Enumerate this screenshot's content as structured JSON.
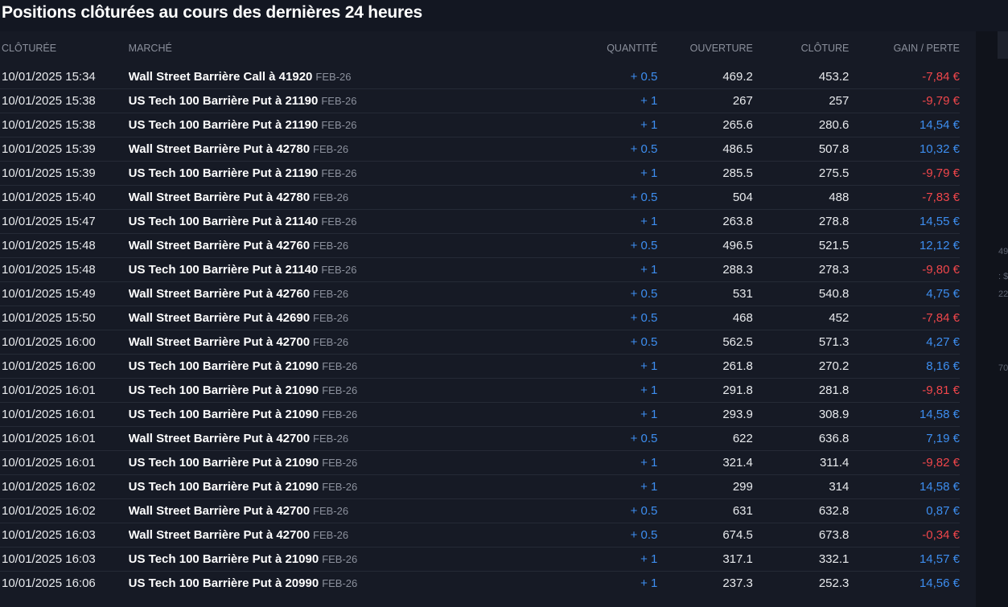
{
  "title": "Positions clôturées au cours des dernières 24 heures",
  "colors": {
    "background": "#131722",
    "panel": "#161a25",
    "positive": "#3d8ef0",
    "negative": "#f0464b",
    "header_text": "#8b909c"
  },
  "table": {
    "headers": {
      "closed": "CLÔTURÉE",
      "market": "MARCHÉ",
      "quantity": "QUANTITÉ",
      "open": "OUVERTURE",
      "close": "CLÔTURE",
      "pl": "GAIN / PERTE"
    },
    "rows": [
      {
        "date": "10/01/2025 15:34",
        "market": "Wall Street Barrière Call à 41920",
        "expiry": "FEB-26",
        "qty": "+ 0.5",
        "open": "469.2",
        "close": "453.2",
        "pl": "-7,84 €",
        "sign": "neg"
      },
      {
        "date": "10/01/2025 15:38",
        "market": "US Tech 100 Barrière Put à 21190",
        "expiry": "FEB-26",
        "qty": "+ 1",
        "open": "267",
        "close": "257",
        "pl": "-9,79 €",
        "sign": "neg"
      },
      {
        "date": "10/01/2025 15:38",
        "market": "US Tech 100 Barrière Put à 21190",
        "expiry": "FEB-26",
        "qty": "+ 1",
        "open": "265.6",
        "close": "280.6",
        "pl": "14,54 €",
        "sign": "pos"
      },
      {
        "date": "10/01/2025 15:39",
        "market": "Wall Street Barrière Put à 42780",
        "expiry": "FEB-26",
        "qty": "+ 0.5",
        "open": "486.5",
        "close": "507.8",
        "pl": "10,32 €",
        "sign": "pos"
      },
      {
        "date": "10/01/2025 15:39",
        "market": "US Tech 100 Barrière Put à 21190",
        "expiry": "FEB-26",
        "qty": "+ 1",
        "open": "285.5",
        "close": "275.5",
        "pl": "-9,79 €",
        "sign": "neg"
      },
      {
        "date": "10/01/2025 15:40",
        "market": "Wall Street Barrière Put à 42780",
        "expiry": "FEB-26",
        "qty": "+ 0.5",
        "open": "504",
        "close": "488",
        "pl": "-7,83 €",
        "sign": "neg"
      },
      {
        "date": "10/01/2025 15:47",
        "market": "US Tech 100 Barrière Put à 21140",
        "expiry": "FEB-26",
        "qty": "+ 1",
        "open": "263.8",
        "close": "278.8",
        "pl": "14,55 €",
        "sign": "pos"
      },
      {
        "date": "10/01/2025 15:48",
        "market": "Wall Street Barrière Put à 42760",
        "expiry": "FEB-26",
        "qty": "+ 0.5",
        "open": "496.5",
        "close": "521.5",
        "pl": "12,12 €",
        "sign": "pos"
      },
      {
        "date": "10/01/2025 15:48",
        "market": "US Tech 100 Barrière Put à 21140",
        "expiry": "FEB-26",
        "qty": "+ 1",
        "open": "288.3",
        "close": "278.3",
        "pl": "-9,80 €",
        "sign": "neg"
      },
      {
        "date": "10/01/2025 15:49",
        "market": "Wall Street Barrière Put à 42760",
        "expiry": "FEB-26",
        "qty": "+ 0.5",
        "open": "531",
        "close": "540.8",
        "pl": "4,75 €",
        "sign": "pos"
      },
      {
        "date": "10/01/2025 15:50",
        "market": "Wall Street Barrière Put à 42690",
        "expiry": "FEB-26",
        "qty": "+ 0.5",
        "open": "468",
        "close": "452",
        "pl": "-7,84 €",
        "sign": "neg"
      },
      {
        "date": "10/01/2025 16:00",
        "market": "Wall Street Barrière Put à 42700",
        "expiry": "FEB-26",
        "qty": "+ 0.5",
        "open": "562.5",
        "close": "571.3",
        "pl": "4,27 €",
        "sign": "pos"
      },
      {
        "date": "10/01/2025 16:00",
        "market": "US Tech 100 Barrière Put à 21090",
        "expiry": "FEB-26",
        "qty": "+ 1",
        "open": "261.8",
        "close": "270.2",
        "pl": "8,16 €",
        "sign": "pos"
      },
      {
        "date": "10/01/2025 16:01",
        "market": "US Tech 100 Barrière Put à 21090",
        "expiry": "FEB-26",
        "qty": "+ 1",
        "open": "291.8",
        "close": "281.8",
        "pl": "-9,81 €",
        "sign": "neg"
      },
      {
        "date": "10/01/2025 16:01",
        "market": "US Tech 100 Barrière Put à 21090",
        "expiry": "FEB-26",
        "qty": "+ 1",
        "open": "293.9",
        "close": "308.9",
        "pl": "14,58 €",
        "sign": "pos"
      },
      {
        "date": "10/01/2025 16:01",
        "market": "Wall Street Barrière Put à 42700",
        "expiry": "FEB-26",
        "qty": "+ 0.5",
        "open": "622",
        "close": "636.8",
        "pl": "7,19 €",
        "sign": "pos"
      },
      {
        "date": "10/01/2025 16:01",
        "market": "US Tech 100 Barrière Put à 21090",
        "expiry": "FEB-26",
        "qty": "+ 1",
        "open": "321.4",
        "close": "311.4",
        "pl": "-9,82 €",
        "sign": "neg"
      },
      {
        "date": "10/01/2025 16:02",
        "market": "US Tech 100 Barrière Put à 21090",
        "expiry": "FEB-26",
        "qty": "+ 1",
        "open": "299",
        "close": "314",
        "pl": "14,58 €",
        "sign": "pos"
      },
      {
        "date": "10/01/2025 16:02",
        "market": "Wall Street Barrière Put à 42700",
        "expiry": "FEB-26",
        "qty": "+ 0.5",
        "open": "631",
        "close": "632.8",
        "pl": "0,87 €",
        "sign": "pos"
      },
      {
        "date": "10/01/2025 16:03",
        "market": "Wall Street Barrière Put à 42700",
        "expiry": "FEB-26",
        "qty": "+ 0.5",
        "open": "674.5",
        "close": "673.8",
        "pl": "-0,34 €",
        "sign": "neg"
      },
      {
        "date": "10/01/2025 16:03",
        "market": "US Tech 100 Barrière Put à 21090",
        "expiry": "FEB-26",
        "qty": "+ 1",
        "open": "317.1",
        "close": "332.1",
        "pl": "14,57 €",
        "sign": "pos"
      },
      {
        "date": "10/01/2025 16:06",
        "market": "US Tech 100 Barrière Put à 20990",
        "expiry": "FEB-26",
        "qty": "+ 1",
        "open": "237.3",
        "close": "252.3",
        "pl": "14,56 €",
        "sign": "pos"
      }
    ]
  },
  "edge_fragments": [
    "49",
    ": $",
    "22",
    "70"
  ]
}
